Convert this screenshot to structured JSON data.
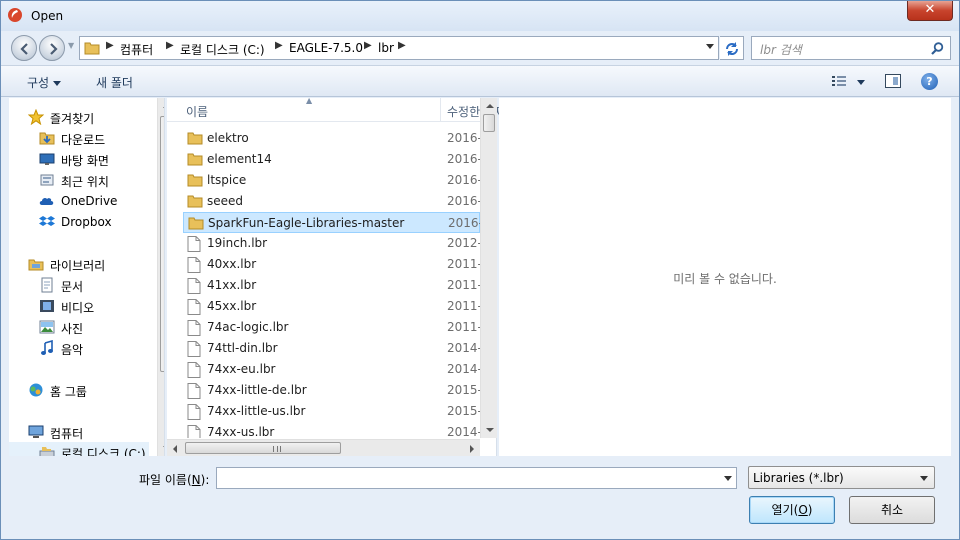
{
  "window": {
    "title": "Open",
    "close_label": "✕"
  },
  "address": {
    "crumbs": [
      "컴퓨터",
      "로컬 디스크 (C:)",
      "EAGLE-7.5.0",
      "lbr"
    ]
  },
  "search": {
    "placeholder": "lbr 검색"
  },
  "toolbar": {
    "organize_label": "구성",
    "new_folder_label": "새 폴더",
    "help_label": "?"
  },
  "nav": {
    "favorites": "즐겨찾기",
    "downloads": "다운로드",
    "desktop": "바탕 화면",
    "recent": "최근 위치",
    "onedrive": "OneDrive",
    "dropbox": "Dropbox",
    "libraries": "라이브러리",
    "documents": "문서",
    "videos": "비디오",
    "pictures": "사진",
    "music": "음악",
    "homegroup": "홈 그룹",
    "computer": "컴퓨터",
    "local_disk": "로컬 디스크 (C:)"
  },
  "columns": {
    "name": "이름",
    "date": "수정한 날짜"
  },
  "files": [
    {
      "name": "elektro",
      "date": "2016-",
      "type": "folder"
    },
    {
      "name": "element14",
      "date": "2016-",
      "type": "folder"
    },
    {
      "name": "ltspice",
      "date": "2016-",
      "type": "folder"
    },
    {
      "name": "seeed",
      "date": "2016-",
      "type": "folder"
    },
    {
      "name": "SparkFun-Eagle-Libraries-master",
      "date": "2016-",
      "type": "folder",
      "selected": true
    },
    {
      "name": "19inch.lbr",
      "date": "2012-",
      "type": "file"
    },
    {
      "name": "40xx.lbr",
      "date": "2011-",
      "type": "file"
    },
    {
      "name": "41xx.lbr",
      "date": "2011-",
      "type": "file"
    },
    {
      "name": "45xx.lbr",
      "date": "2011-",
      "type": "file"
    },
    {
      "name": "74ac-logic.lbr",
      "date": "2011-",
      "type": "file"
    },
    {
      "name": "74ttl-din.lbr",
      "date": "2014-",
      "type": "file"
    },
    {
      "name": "74xx-eu.lbr",
      "date": "2014-",
      "type": "file"
    },
    {
      "name": "74xx-little-de.lbr",
      "date": "2015-",
      "type": "file"
    },
    {
      "name": "74xx-little-us.lbr",
      "date": "2015-",
      "type": "file"
    },
    {
      "name": "74xx-us.lbr",
      "date": "2014-",
      "type": "file"
    }
  ],
  "preview": {
    "message": "미리 볼 수 없습니다."
  },
  "bottom": {
    "filename_label_prefix": "파일 이름(",
    "filename_label_key": "N",
    "filename_label_suffix": "):",
    "filename_value": "",
    "filter_value": "Libraries (*.lbr)",
    "open_prefix": "열기(",
    "open_key": "O",
    "open_suffix": ")",
    "cancel_label": "취소"
  }
}
